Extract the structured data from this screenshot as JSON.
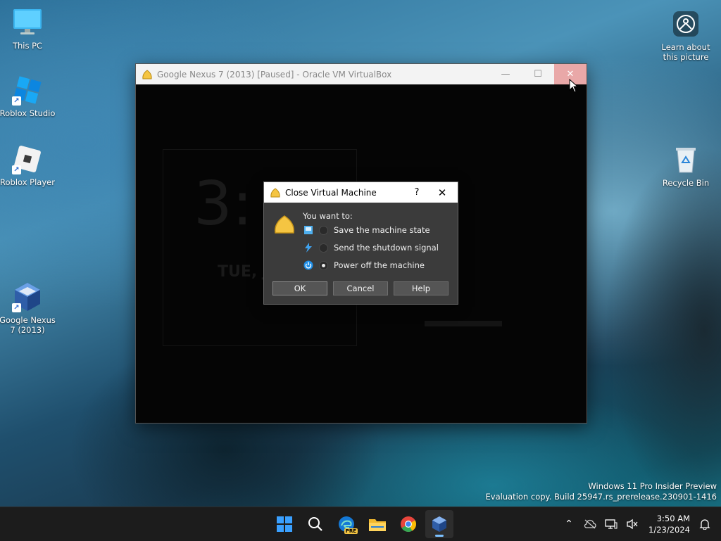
{
  "desktop": {
    "icons": [
      {
        "label": "This PC"
      },
      {
        "label": "Roblox Studio"
      },
      {
        "label": "Roblox Player"
      },
      {
        "label": "Google Nexus 7 (2013)"
      }
    ],
    "learn_about": "Learn about this picture",
    "recycle_bin": "Recycle Bin"
  },
  "vm_window": {
    "title": "Google Nexus 7 (2013) [Paused] - Oracle VM VirtualBox",
    "screen_clock": "3:",
    "screen_date": "TUE, J"
  },
  "dialog": {
    "title": "Close Virtual Machine",
    "help_glyph": "?",
    "close_glyph": "✕",
    "prompt": "You want to:",
    "options": [
      {
        "label": "Save the machine state",
        "checked": false
      },
      {
        "label": "Send the shutdown signal",
        "checked": false
      },
      {
        "label": "Power off the machine",
        "checked": true
      }
    ],
    "buttons": {
      "ok": "OK",
      "cancel": "Cancel",
      "help": "Help"
    }
  },
  "watermark": {
    "line1": "Windows 11 Pro Insider Preview",
    "line2": "Evaluation copy. Build 25947.rs_prerelease.230901-1416"
  },
  "taskbar": {
    "time": "3:50 AM",
    "date": "1/23/2024",
    "edge_badge": "PRE"
  },
  "colors": {
    "vbox_yellow": "#f5c542",
    "accent_blue": "#0a84ff",
    "close_hover": "#e9a8a8"
  }
}
